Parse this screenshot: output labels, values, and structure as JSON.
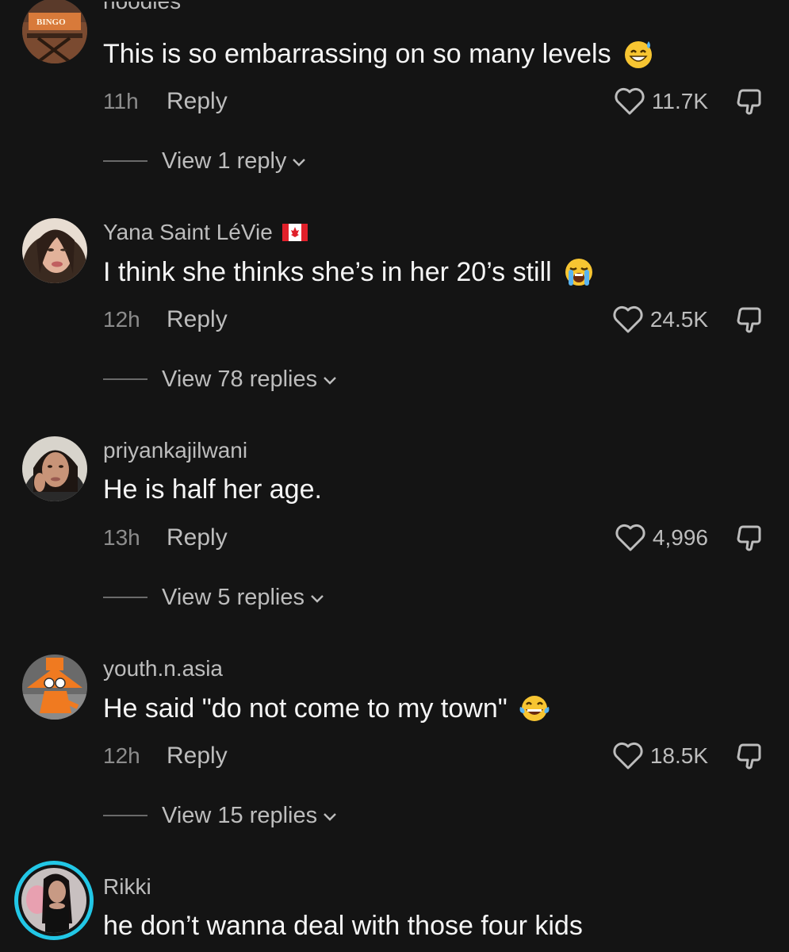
{
  "comments": [
    {
      "username": "noodles",
      "text": "This is so embarrassing on so many levels",
      "time": "11h",
      "reply_label": "Reply",
      "likes": "11.7K",
      "view_replies": "View 1 reply",
      "avatar_badge": "BINGO"
    },
    {
      "username": "Yana Saint LéVie",
      "text": "I think she thinks she’s in her 20’s still",
      "time": "12h",
      "reply_label": "Reply",
      "likes": "24.5K",
      "view_replies": "View 78 replies"
    },
    {
      "username": "priyankajilwani",
      "text": "He is half her age.",
      "time": "13h",
      "reply_label": "Reply",
      "likes": "4,996",
      "view_replies": "View 5 replies"
    },
    {
      "username": "youth.n.asia",
      "text": "He said \"do not come to my town\"",
      "time": "12h",
      "reply_label": "Reply",
      "likes": "18.5K",
      "view_replies": "View 15 replies"
    },
    {
      "username": "Rikki",
      "text": "he don’t wanna deal with those four kids"
    }
  ],
  "colors": {
    "background": "#141414",
    "primary_text": "#f5f5f5",
    "secondary_text": "#bdbdbd",
    "muted_text": "#8c8c8c",
    "story_ring": "#22c7e6"
  },
  "icons": {
    "like": "heart-outline-icon",
    "dislike": "thumbs-down-icon",
    "expand": "chevron-down-icon"
  }
}
